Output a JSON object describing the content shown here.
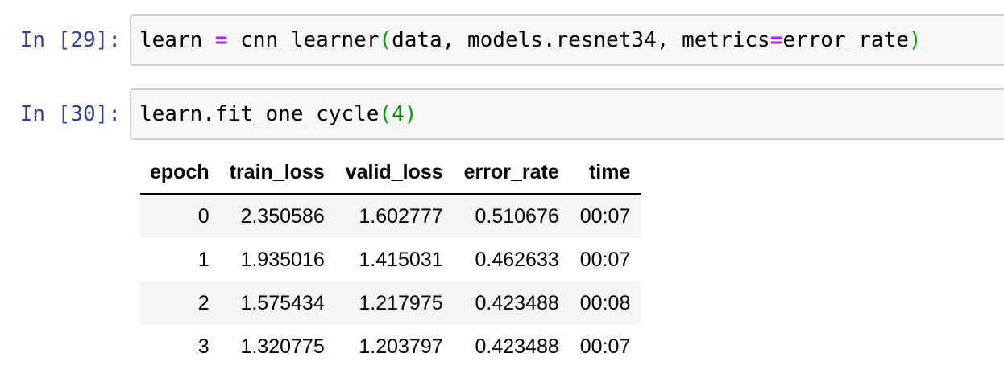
{
  "cells": [
    {
      "prompt": "In [29]:",
      "code": {
        "t1": "learn ",
        "op1": "=",
        "t2": " cnn_learner",
        "p1": "(",
        "t3": "data, models.resnet34, metrics",
        "op2": "=",
        "t4": "error_rate",
        "p2": ")"
      }
    },
    {
      "prompt": "In [30]:",
      "code": {
        "t1": "learn.fit_one_cycle",
        "p1": "(",
        "num": "4",
        "p2": ")"
      }
    }
  ],
  "table": {
    "headers": [
      "epoch",
      "train_loss",
      "valid_loss",
      "error_rate",
      "time"
    ],
    "rows": [
      [
        "0",
        "2.350586",
        "1.602777",
        "0.510676",
        "00:07"
      ],
      [
        "1",
        "1.935016",
        "1.415031",
        "0.462633",
        "00:07"
      ],
      [
        "2",
        "1.575434",
        "1.217975",
        "0.423488",
        "00:08"
      ],
      [
        "3",
        "1.320775",
        "1.203797",
        "0.423488",
        "00:07"
      ]
    ]
  }
}
